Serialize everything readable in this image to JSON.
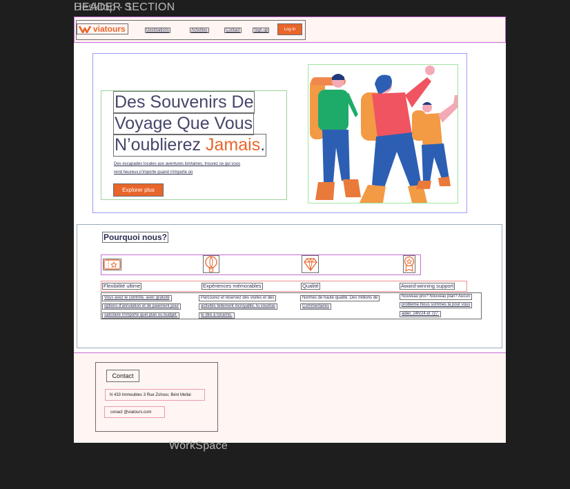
{
  "canvas": {
    "frame_label_overlap_a": "HEADER SECTION",
    "frame_label_overlap_b": "Desktop - 1",
    "workspace_label": "WorkSpace"
  },
  "header": {
    "logo_text": "viatours",
    "nav": [
      "Destinations",
      "Activities",
      "Contact",
      "Sign up"
    ],
    "login_label": "Log In"
  },
  "hero": {
    "title_line1": "Des Souvenirs De",
    "title_line2": "Voyage Que Vous",
    "title_line3_prefix": "N’oublierez",
    "title_line3_accent": "Jamais",
    "title_line3_suffix": ".",
    "desc_line1": "Des escapades locales aux aventures lointaines, trouvez ce qui vous",
    "desc_line2": "rend heureux,n'importe quand n'importe où",
    "cta_label": "Explorer plus"
  },
  "why": {
    "title": "Pourquoi nous?",
    "features": [
      {
        "icon": "ticket-icon",
        "title": "Flexibilité ultime",
        "lines": [
          "Vous avez le contrôle, avec gratuité",
          "options d'annulation et de paiement pour",
          "satisfaire n'importe quel plan ou budget."
        ]
      },
      {
        "icon": "hot-air-balloon-icon",
        "title": "Expériences mémorables",
        "lines": [
          "Parcourez et réservez des visites et des",
          "activités tellement incroyable, tu voudras",
          "le dire à tonamis."
        ]
      },
      {
        "icon": "diamond-icon",
        "title": "Qualité",
        "lines": [
          "Normes de haute qualité. Des millions de",
          "Commentaires"
        ]
      },
      {
        "icon": "award-badge-icon",
        "title": "Award-winning support",
        "lines": [
          "Nouveau prix? Nouveau plan? Aucun",
          "problème.Nous sommes là pour vous",
          "aider, 24h/24 et 7j/7."
        ]
      }
    ]
  },
  "footer": {
    "contact_title": "Contact",
    "address": "N 433 Immeubles 3 Rue Zohour, Béni Mellal",
    "email": "conact @viatours.com"
  },
  "colors": {
    "accent": "#e8652b",
    "navy": "#2b2d52",
    "header_bg": "#fff5f2"
  }
}
